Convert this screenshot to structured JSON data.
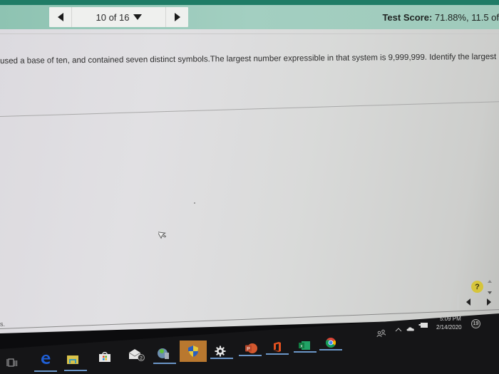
{
  "header": {
    "question_counter": "10 of 16",
    "score_label": "Test Score:",
    "score_value": " 71.88%, 11.5 of "
  },
  "question": {
    "text": "used a base of ten, and contained seven distinct symbols.The largest number expressible in that system is 9,999,999. Identify the largest number"
  },
  "help": {
    "label": "?"
  },
  "footer": {
    "text": "s."
  },
  "taskbar": {
    "apps": [
      {
        "name": "task-view",
        "label": "Task View"
      },
      {
        "name": "edge",
        "label": "Microsoft Edge"
      },
      {
        "name": "file-explorer",
        "label": "File Explorer"
      },
      {
        "name": "store",
        "label": "Microsoft Store"
      },
      {
        "name": "mail",
        "label": "Mail",
        "badge": "2"
      },
      {
        "name": "app-globe",
        "label": "App"
      },
      {
        "name": "security",
        "label": "Windows Security"
      },
      {
        "name": "settings",
        "label": "Settings"
      },
      {
        "name": "powerpoint",
        "label": "PowerPoint"
      },
      {
        "name": "office",
        "label": "Office"
      },
      {
        "name": "excel",
        "label": "Excel"
      },
      {
        "name": "chrome",
        "label": "Google Chrome"
      }
    ],
    "tray": {
      "time": "5:09 PM",
      "date": "2/14/2020",
      "notification_count": "19"
    }
  },
  "colors": {
    "header_bg": "#9fcabb",
    "top_strip": "#1f7c66",
    "help_button": "#d6c53a",
    "taskbar_bg": "#151517",
    "taskbar_indicator": "#6b96c8"
  }
}
